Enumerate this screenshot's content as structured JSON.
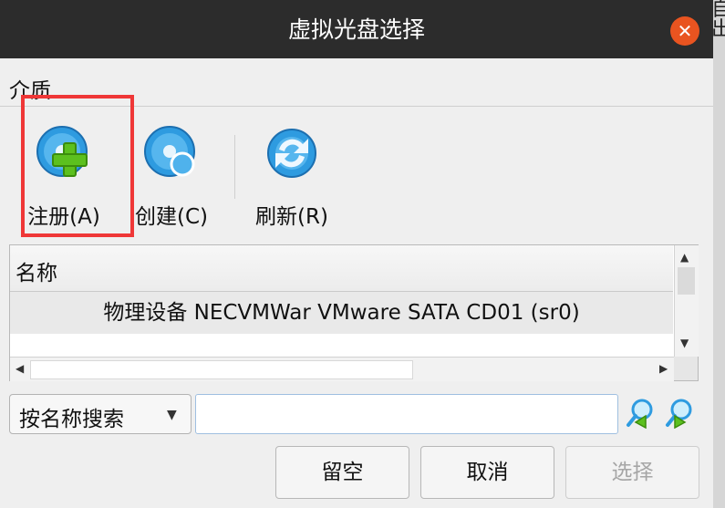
{
  "window": {
    "title": "虚拟光盘选择",
    "edge_text": "自\n出"
  },
  "menu": {
    "items": [
      "介质"
    ]
  },
  "toolbar": {
    "add": {
      "label": "注册(A)",
      "icon": "disc-add-icon"
    },
    "create": {
      "label": "创建(C)",
      "icon": "disc-create-icon"
    },
    "refresh": {
      "label": "刷新(R)",
      "icon": "refresh-icon"
    }
  },
  "list": {
    "columns": [
      "名称"
    ],
    "rows": [
      {
        "name": "物理设备 NECVMWar VMware SATA CD01 (sr0)"
      }
    ]
  },
  "search": {
    "mode": "按名称搜索",
    "value": ""
  },
  "buttons": {
    "leave_empty": "留空",
    "cancel": "取消",
    "choose": "选择"
  },
  "colors": {
    "titlebar": "#2c2c2c",
    "close": "#e95420",
    "highlight": "#ef3737",
    "icon_blue": "#2e9be0",
    "icon_green": "#5cc01e"
  }
}
